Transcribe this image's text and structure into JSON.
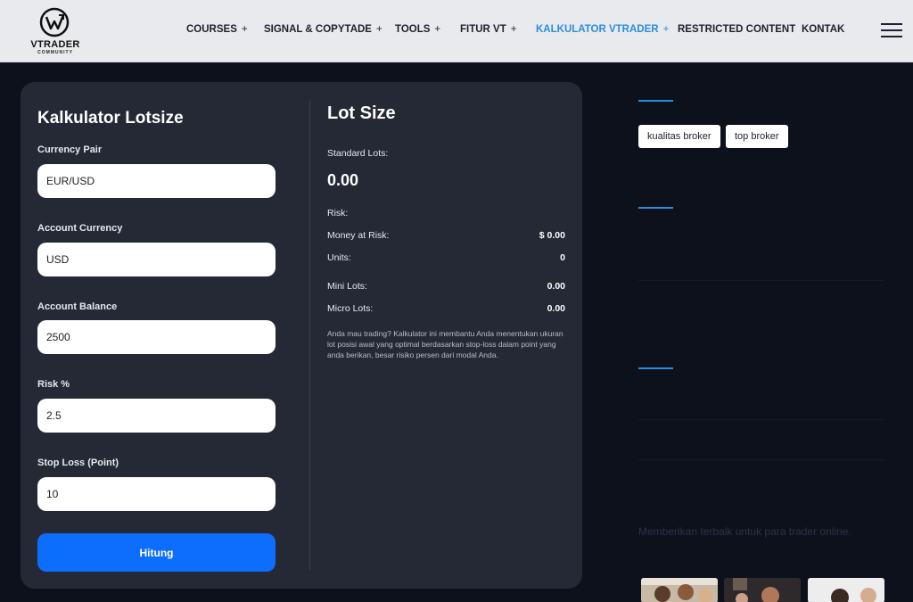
{
  "brand": {
    "name": "VTRADER",
    "sub": "COMMUNITY"
  },
  "nav": [
    {
      "label": "COURSES",
      "plus": "+",
      "active": false
    },
    {
      "label": "SIGNAL & COPYTADE",
      "plus": "+",
      "active": false
    },
    {
      "label": "TOOLS",
      "plus": "+",
      "active": false
    },
    {
      "label": "FITUR VT",
      "plus": "+",
      "active": false
    },
    {
      "label": "KALKULATOR VTRADER",
      "plus": "+",
      "active": true
    },
    {
      "label": "RESTRICTED CONTENT",
      "plus": "",
      "active": false
    },
    {
      "label": "KONTAK",
      "plus": "",
      "active": false
    }
  ],
  "calculator": {
    "title": "Kalkulator Lotsize",
    "fields": [
      {
        "label": "Currency Pair",
        "value": "EUR/USD"
      },
      {
        "label": "Account Currency",
        "value": "USD"
      },
      {
        "label": "Account Balance",
        "value": "2500"
      },
      {
        "label": "Risk %",
        "value": "2.5"
      },
      {
        "label": "Stop Loss (Point)",
        "value": "10"
      }
    ],
    "button": "Hitung"
  },
  "result": {
    "title": "Lot Size",
    "standard_label": "Standard Lots:",
    "standard_value": "0.00",
    "risk_label": "Risk:",
    "rows": [
      {
        "label": "Money at Risk:",
        "value": "$ 0.00"
      },
      {
        "label": "Units:",
        "value": "0"
      },
      {
        "label": "Mini Lots:",
        "value": "0.00"
      },
      {
        "label": "Micro Lots:",
        "value": "0.00"
      }
    ],
    "description": "Anda mau trading? Kalkulator ini membantu Anda menentukan ukuran lot posisi awal yang optimal berdasarkan stop-loss dalam point yang anda berikan, besar risiko persen dari modal Anda."
  },
  "sidebar": {
    "tags": [
      "kualitas broker",
      "top broker"
    ],
    "tagline": "Memberikan terbaik untuk para trader online."
  },
  "colors": {
    "accent": "#2b8de0",
    "button": "#0d6efd",
    "card": "#242935",
    "background": "#0d111c"
  }
}
